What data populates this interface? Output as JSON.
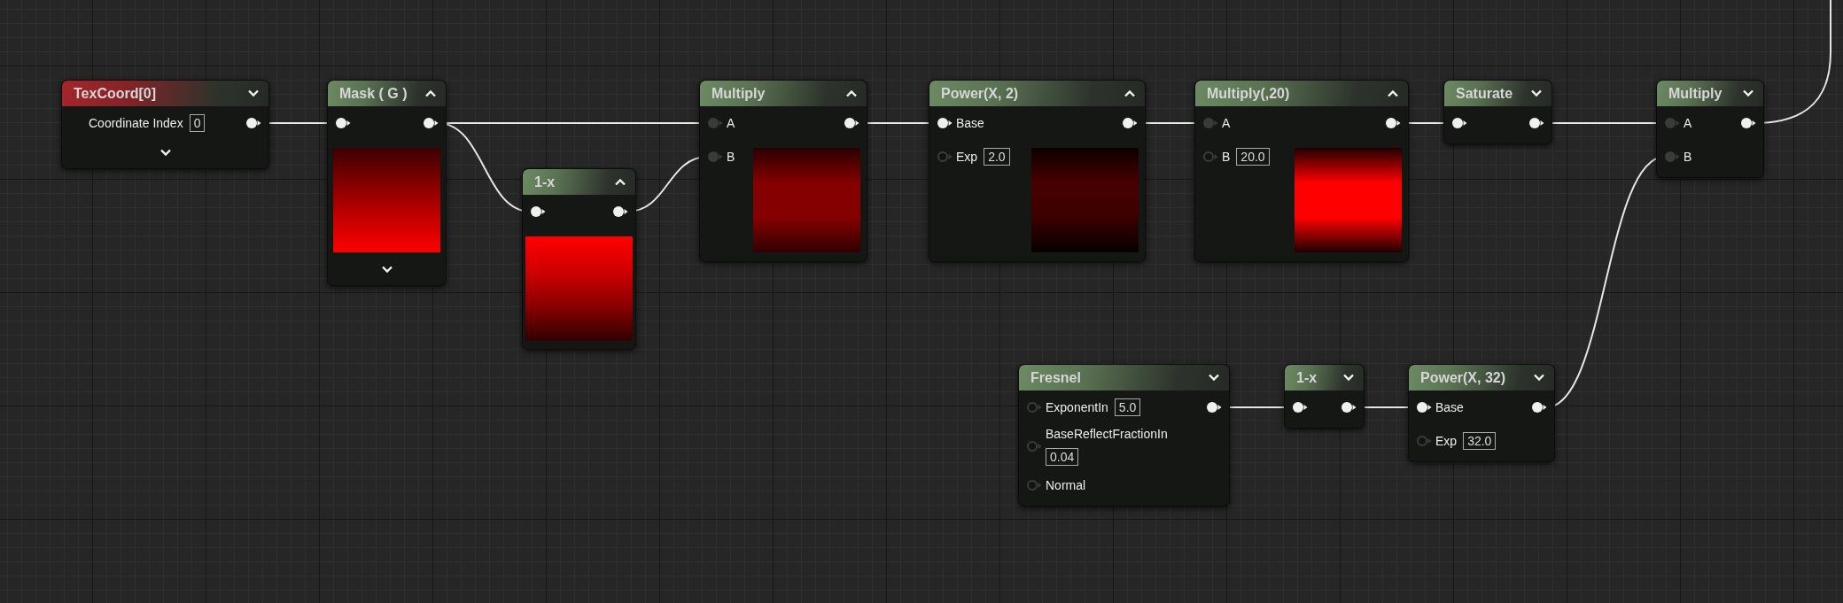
{
  "nodes": [
    {
      "title": "TexCoord[0]",
      "color": "#a3262b",
      "expanded": false,
      "advanced": true,
      "rows": [
        {
          "label": "Coordinate Index",
          "value": "0",
          "out": true
        }
      ]
    },
    {
      "title": "Mask ( G )",
      "color": "#6c8a63",
      "expanded": true,
      "advanced": true,
      "rows": [
        {
          "kind": "solid",
          "out": true
        }
      ],
      "preview": {
        "kind": "below",
        "stops": [
          {
            "color": "#3c0000"
          },
          {
            "color": "#a30000"
          },
          {
            "color": "#ff0000"
          }
        ]
      }
    },
    {
      "title": "1-x",
      "color": "#6c8a63",
      "expanded": true,
      "advanced": false,
      "rows": [
        {
          "kind": "solid",
          "out": true
        }
      ],
      "preview": {
        "kind": "below",
        "stops": [
          {
            "color": "#ff0000"
          },
          {
            "color": "#d00000"
          },
          {
            "color": "#8a0000"
          },
          {
            "color": "#300000"
          }
        ]
      }
    },
    {
      "title": "Multiply",
      "color": "#6c8a63",
      "expanded": true,
      "advanced": false,
      "rows": [
        {
          "kind": "dim",
          "label": "A",
          "out": true
        },
        {
          "kind": "dim",
          "label": "B"
        }
      ],
      "preview": {
        "kind": "side",
        "stops": [
          {
            "color": "#2a0000"
          },
          {
            "color": "#850000"
          },
          {
            "color": "#850000"
          },
          {
            "color": "#300000"
          }
        ]
      }
    },
    {
      "title": "Power(X, 2)",
      "color": "#6c8a63",
      "expanded": true,
      "advanced": false,
      "rows": [
        {
          "kind": "solid",
          "label": "Base",
          "out": true
        },
        {
          "kind": "hollow",
          "label": "Exp",
          "value": "2.0"
        }
      ],
      "preview": {
        "kind": "side",
        "stops": [
          {
            "color": "#0c0000"
          },
          {
            "color": "#480000"
          },
          {
            "color": "#3c0000"
          },
          {
            "color": "#060000"
          }
        ]
      }
    },
    {
      "title": "Multiply(,20)",
      "color": "#6c8a63",
      "expanded": true,
      "advanced": false,
      "rows": [
        {
          "kind": "dim",
          "label": "A",
          "out": true
        },
        {
          "kind": "hollow",
          "label": "B",
          "value": "20.0"
        }
      ],
      "preview": {
        "kind": "side",
        "stops": [
          {
            "color": "#200000"
          },
          {
            "color": "#ff0000"
          },
          {
            "color": "#ff0000"
          },
          {
            "color": "#200000"
          }
        ]
      }
    },
    {
      "title": "Saturate",
      "color": "#6c8a63",
      "expanded": false,
      "advanced": false,
      "rows": [
        {
          "kind": "solid",
          "out": true
        }
      ]
    },
    {
      "title": "Multiply",
      "color": "#6c8a63",
      "expanded": false,
      "advanced": false,
      "rows": [
        {
          "kind": "dim",
          "label": "A",
          "out": true
        },
        {
          "kind": "dim",
          "label": "B"
        }
      ]
    },
    {
      "title": "Fresnel",
      "color": "#6c8a63",
      "expanded": false,
      "advanced": false,
      "rows": [
        {
          "kind": "hollow",
          "label": "ExponentIn",
          "value": "5.0",
          "out": true
        },
        {
          "kind": "hollow",
          "label": "BaseReflectFractionIn",
          "value": "0.04",
          "value_below": true
        },
        {
          "kind": "hollow",
          "label": "Normal"
        }
      ]
    },
    {
      "title": "1-x",
      "color": "#6c8a63",
      "expanded": false,
      "advanced": false,
      "rows": [
        {
          "kind": "solid",
          "out": true
        }
      ]
    },
    {
      "title": "Power(X, 32)",
      "color": "#6c8a63",
      "expanded": false,
      "advanced": false,
      "rows": [
        {
          "kind": "solid",
          "label": "Base",
          "out": true
        },
        {
          "kind": "hollow",
          "label": "Exp",
          "value": "32.0"
        }
      ]
    }
  ]
}
